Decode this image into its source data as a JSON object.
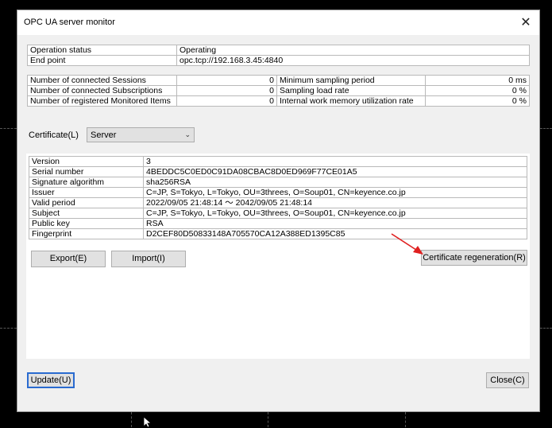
{
  "window": {
    "title": "OPC UA server monitor",
    "close_glyph": "✕"
  },
  "status_table": [
    {
      "label": "Operation status",
      "value": "Operating"
    },
    {
      "label": "End point",
      "value": "opc.tcp://192.168.3.45:4840"
    }
  ],
  "metrics_table": [
    {
      "left_label": "Number of connected Sessions",
      "left_value": "0",
      "right_label": "Minimum sampling period",
      "right_value": "0 ms"
    },
    {
      "left_label": "Number of connected Subscriptions",
      "left_value": "0",
      "right_label": "Sampling load rate",
      "right_value": "0 %"
    },
    {
      "left_label": "Number of registered Monitored Items",
      "left_value": "0",
      "right_label": "Internal work memory utilization rate",
      "right_value": "0 %"
    }
  ],
  "certificate": {
    "label": "Certificate(L)",
    "selected": "Server",
    "details": [
      {
        "label": "Version",
        "value": "3"
      },
      {
        "label": "Serial number",
        "value": "4BEDDC5C0ED0C91DA08CBAC8D0ED969F77CE01A5"
      },
      {
        "label": "Signature algorithm",
        "value": "sha256RSA"
      },
      {
        "label": "Issuer",
        "value": "C=JP, S=Tokyo, L=Tokyo, OU=3threes, O=Soup01, CN=keyence.co.jp"
      },
      {
        "label": "Valid period",
        "value": "2022/09/05 21:48:14 〜 2042/09/05 21:48:14"
      },
      {
        "label": "Subject",
        "value": "C=JP, S=Tokyo, L=Tokyo, OU=3threes, O=Soup01, CN=keyence.co.jp"
      },
      {
        "label": "Public key",
        "value": "RSA"
      },
      {
        "label": "Fingerprint",
        "value": "D2CEF80D50833148A705570CA12A388ED1395C85"
      }
    ]
  },
  "buttons": {
    "export": "Export(E)",
    "import": "Import(I)",
    "regenerate": "Certificate regeneration(R)",
    "update": "Update(U)",
    "close": "Close(C)"
  },
  "colors": {
    "annotation_arrow": "#e02020",
    "focus_border": "#2a6bd0"
  }
}
